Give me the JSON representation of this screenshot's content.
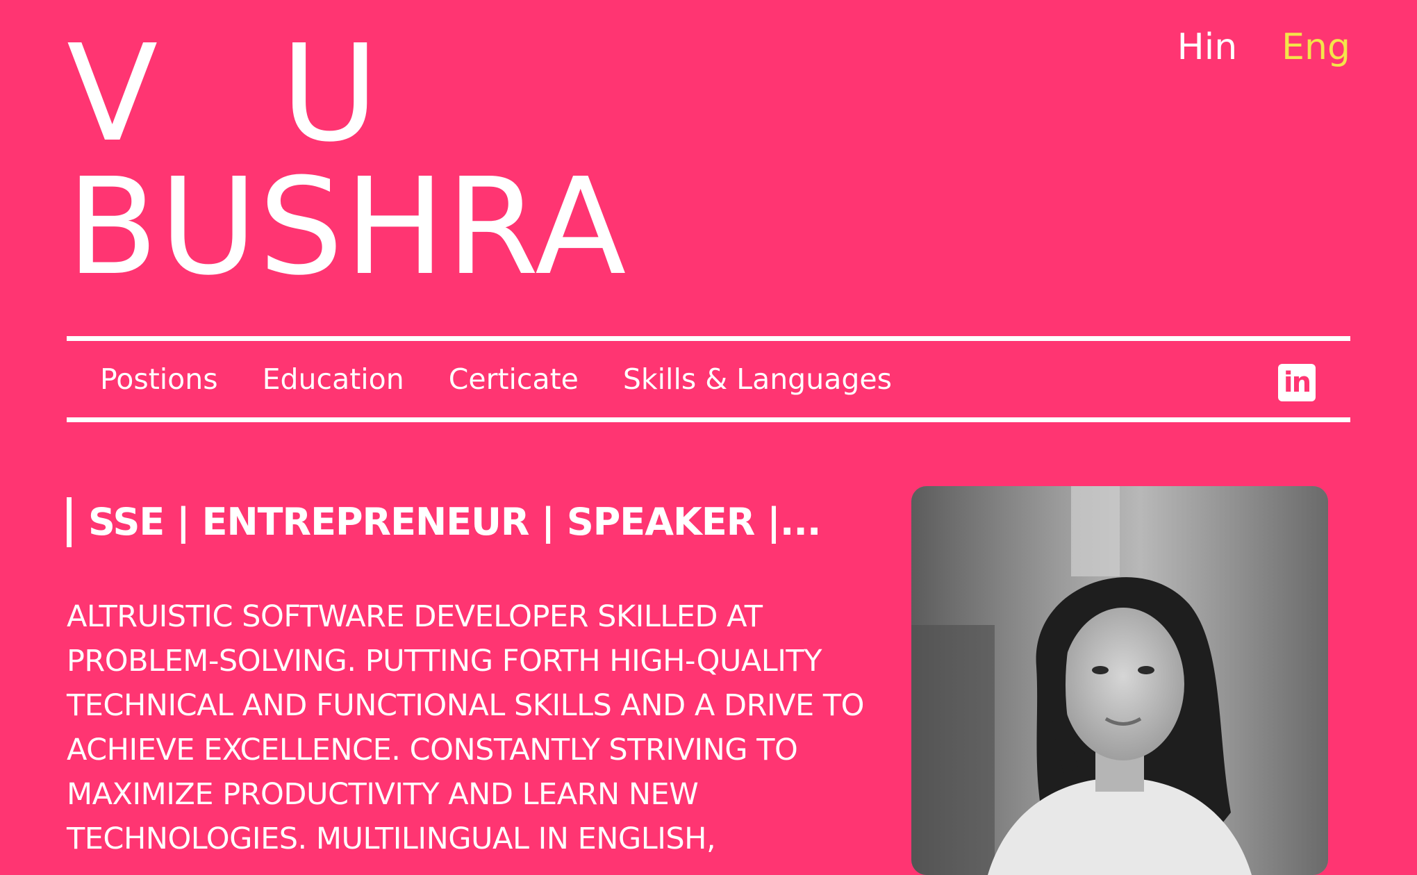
{
  "header": {
    "name_line1": "V U",
    "name_line2": "BUSHRA"
  },
  "languages": [
    {
      "label": "Hin",
      "active": false
    },
    {
      "label": "Eng",
      "active": true
    }
  ],
  "nav": {
    "items": [
      "Postions",
      "Education",
      "Certicate",
      "Skills & Languages"
    ],
    "social_icon": "linkedin-icon",
    "social_label": "in"
  },
  "hero": {
    "subtitle": "SSE | ENTREPRENEUR | SPEAKER |...",
    "bio": "ALTRUISTIC SOFTWARE DEVELOPER SKILLED AT PROBLEM-SOLVING. PUTTING FORTH HIGH-QUALITY TECHNICAL AND FUNCTIONAL SKILLS AND A DRIVE TO ACHIEVE EXCELLENCE. CONSTANTLY STRIVING TO MAXIMIZE PRODUCTIVITY AND LEARN NEW TECHNOLOGIES. MULTILINGUAL IN ENGLISH,"
  },
  "colors": {
    "background": "#ff3572",
    "text": "#ffffff",
    "active_language": "#f4e44a"
  }
}
